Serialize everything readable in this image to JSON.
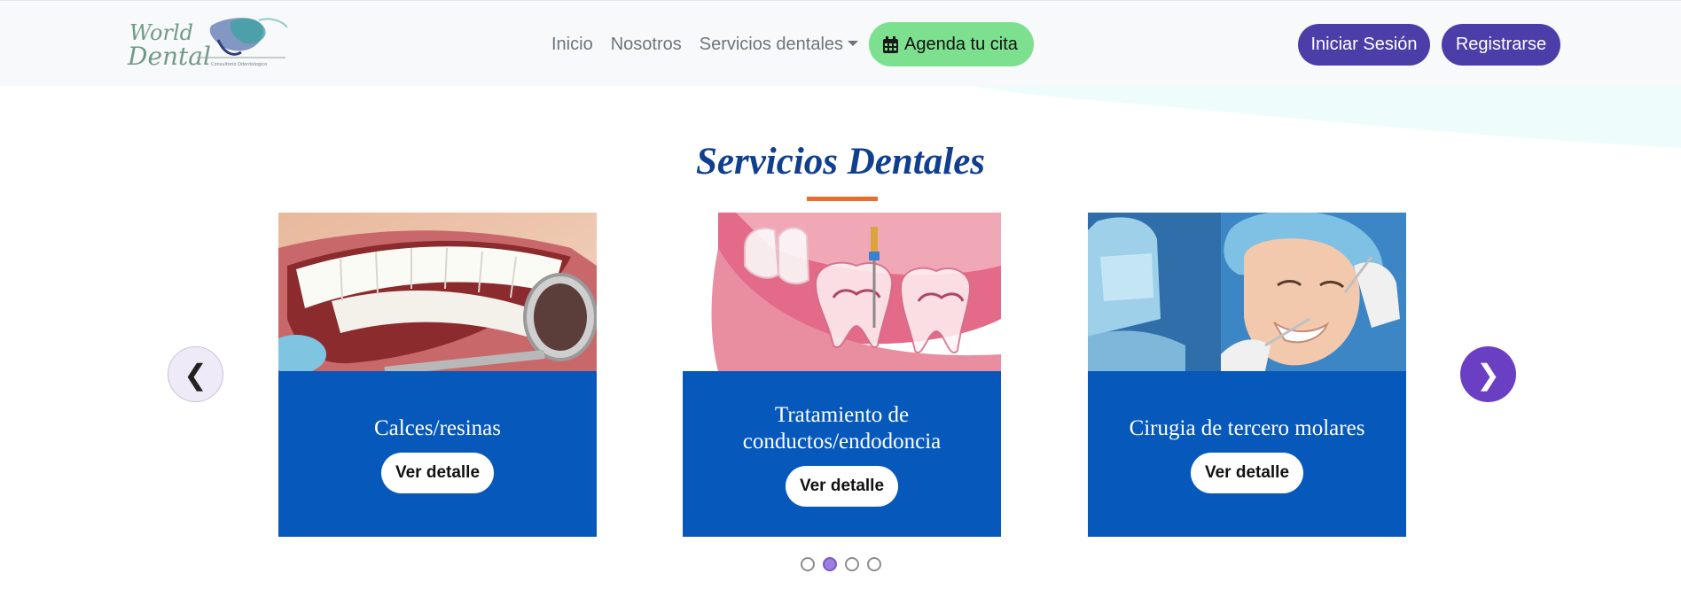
{
  "navbar": {
    "logo_text": {
      "line1": "World",
      "line2": "Dental",
      "tagline": "Consultorio Odontologico"
    },
    "links": {
      "home": "Inicio",
      "about": "Nosotros",
      "services": "Servicios dentales"
    },
    "appointment_label": "Agenda tu cita",
    "login_label": "Iniciar Sesión",
    "register_label": "Registrarse"
  },
  "section": {
    "title": "Servicios Dentales"
  },
  "carousel": {
    "prev_symbol": "❮",
    "next_symbol": "❯",
    "cards": [
      {
        "title": "Calces/resinas",
        "button": "Ver detalle"
      },
      {
        "title": "Tratamiento de conductos/endodoncia",
        "button": "Ver detalle"
      },
      {
        "title": "Cirugia de tercero molares",
        "button": "Ver detalle"
      }
    ],
    "active_dot": 2,
    "dot_count": 4
  },
  "colors": {
    "brand_blue": "#0659bb",
    "title_blue": "#0f3f8e",
    "accent_orange": "#ee6b2b",
    "appointment_green": "#7ce08f",
    "auth_purple": "#4c3ea8",
    "carousel_purple": "#6b3fc3"
  },
  "icons": {
    "appointment": "calendar-icon",
    "prev": "chevron-left-icon",
    "next": "chevron-right-icon"
  }
}
